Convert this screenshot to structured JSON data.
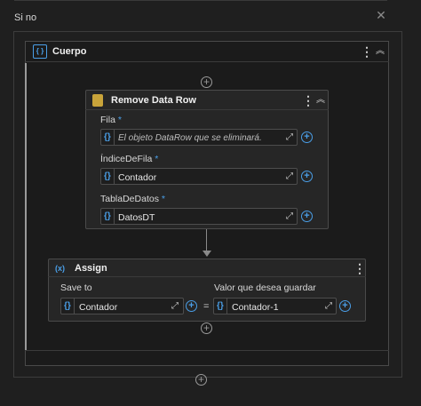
{
  "else_branch": {
    "label": "Si no"
  },
  "body": {
    "title": "Cuerpo",
    "icon": "{ }"
  },
  "remove_data_row": {
    "title": "Remove Data Row",
    "fields": [
      {
        "label": "Fila",
        "required": "*",
        "value": "",
        "placeholder": "El objeto DataRow que se eliminará."
      },
      {
        "label": "ÍndiceDeFila",
        "required": "*",
        "value": "Contador",
        "placeholder": ""
      },
      {
        "label": "TablaDeDatos",
        "required": "*",
        "value": "DatosDT",
        "placeholder": ""
      }
    ]
  },
  "assign": {
    "title": "Assign",
    "icon": "(x)",
    "save_to_label": "Save to",
    "value_label": "Valor que desea guardar",
    "save_to_value": "Contador",
    "equals": "=",
    "value": "Contador-1"
  },
  "icons": {
    "brace": "{}",
    "expand": "⤢",
    "plus": "+",
    "dots": "⋮",
    "collapse": "︽",
    "close": "✕"
  },
  "colors": {
    "accent": "#4a9fe8",
    "background": "#1f1f1f",
    "panel": "#262626",
    "db_icon": "#c9a43a"
  }
}
